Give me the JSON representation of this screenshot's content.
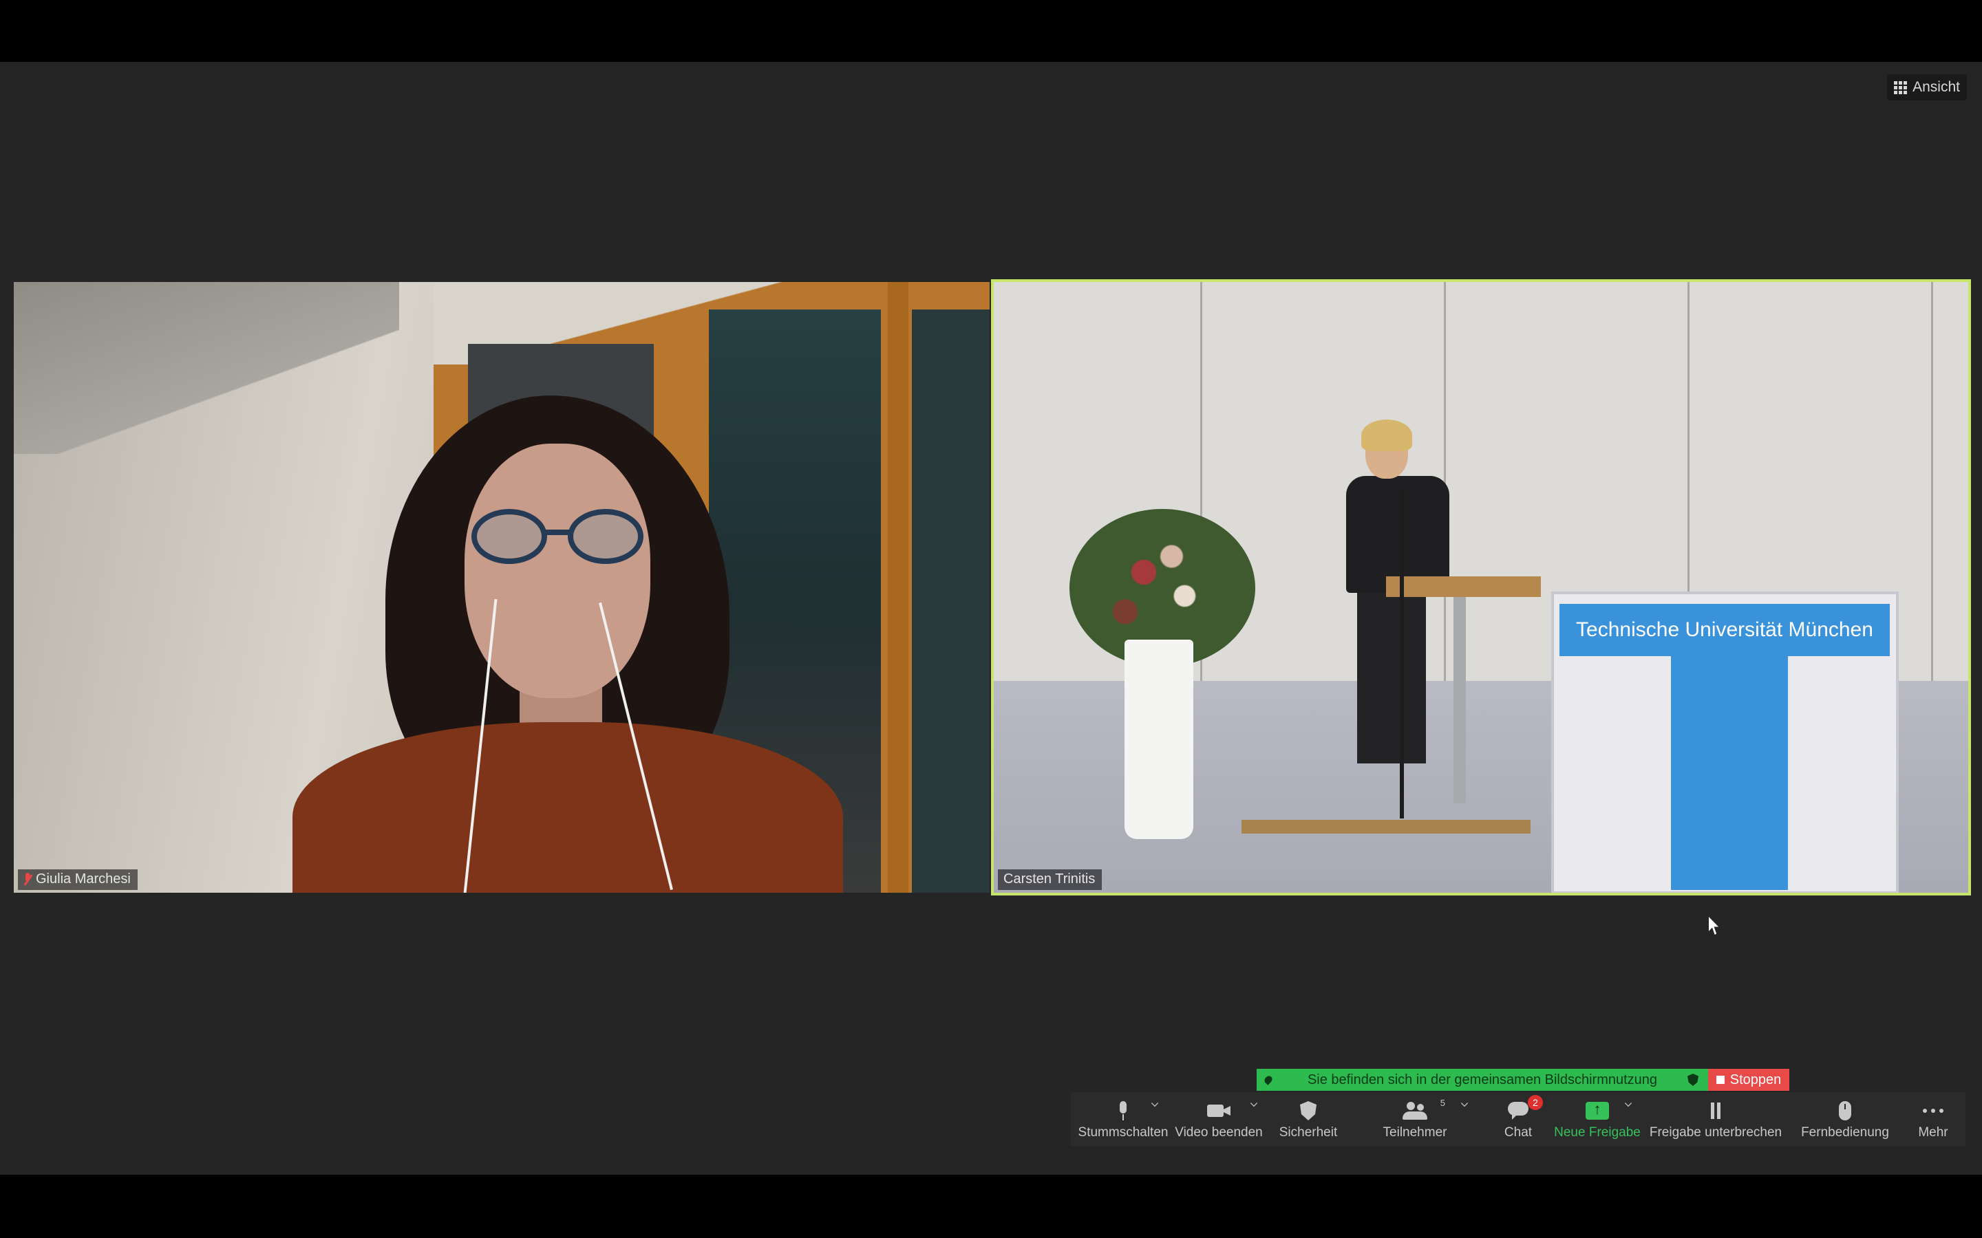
{
  "view_button": {
    "label": "Ansicht"
  },
  "participants": [
    {
      "name": "Giulia Marchesi"
    },
    {
      "name": "Carsten Trinitis"
    }
  ],
  "stage_sign": {
    "text": "Technische Universität München"
  },
  "share_banner": {
    "message": "Sie befinden sich in der gemeinsamen Bildschirmnutzung",
    "stop_label": "Stoppen"
  },
  "toolbar": {
    "mute_label": "Stummschalten",
    "video_label": "Video beenden",
    "security_label": "Sicherheit",
    "participants_label": "Teilnehmer",
    "participants_count": "5",
    "chat_label": "Chat",
    "chat_badge": "2",
    "new_share_label": "Neue Freigabe",
    "pause_share_label": "Freigabe unterbrechen",
    "remote_control_label": "Fernbedienung",
    "more_label": "Mehr"
  },
  "colors": {
    "active_speaker_border": "#c9e46b",
    "share_green": "#2dbb4f",
    "stop_red": "#e84a4a",
    "toolbar_bg": "#2b2b2c",
    "meeting_bg": "#252526"
  }
}
